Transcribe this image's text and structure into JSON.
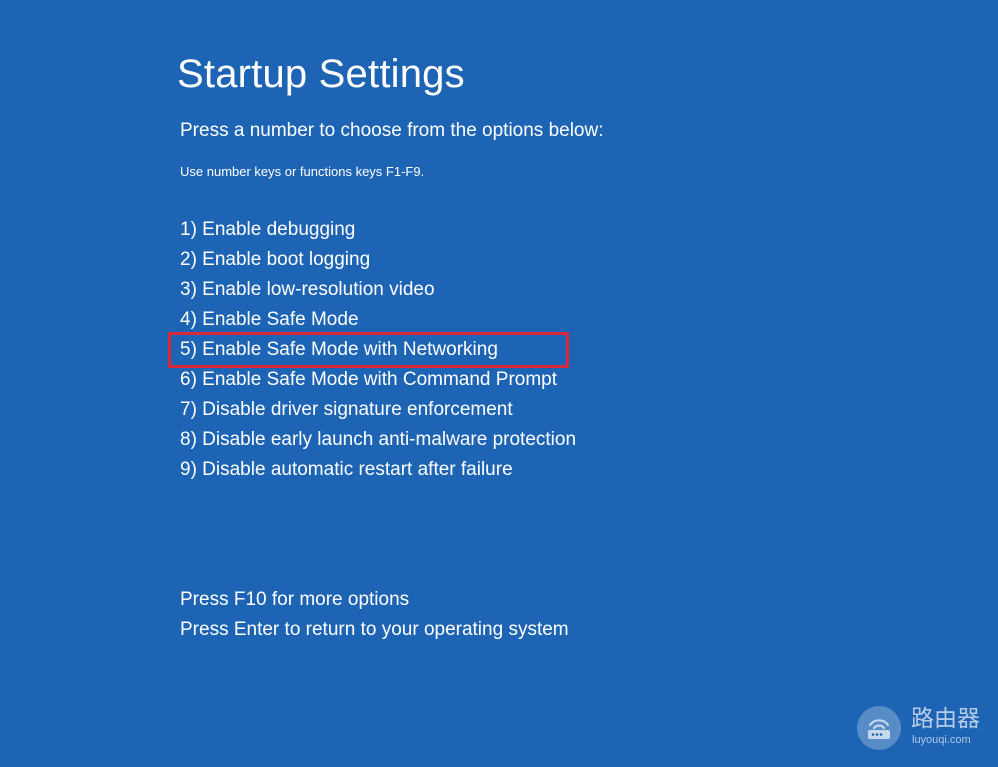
{
  "screen": {
    "title": "Startup Settings",
    "subtitle": "Press a number to choose from the options below:",
    "hint": "Use number keys or functions keys F1-F9.",
    "background_color": "#1e64b4",
    "highlight_color": "#d7283c"
  },
  "options": [
    {
      "label": "1) Enable debugging",
      "highlighted": false
    },
    {
      "label": "2) Enable boot logging",
      "highlighted": false
    },
    {
      "label": "3) Enable low-resolution video",
      "highlighted": false
    },
    {
      "label": "4) Enable Safe Mode",
      "highlighted": false
    },
    {
      "label": "5) Enable Safe Mode with Networking",
      "highlighted": true
    },
    {
      "label": "6) Enable Safe Mode with Command Prompt",
      "highlighted": false
    },
    {
      "label": "7) Disable driver signature enforcement",
      "highlighted": false
    },
    {
      "label": "8) Disable early launch anti-malware protection",
      "highlighted": false
    },
    {
      "label": "9) Disable automatic restart after failure",
      "highlighted": false
    }
  ],
  "footer": {
    "more_options": "Press F10 for more options",
    "return": "Press Enter to return to your operating system"
  },
  "watermark": {
    "name": "路由器",
    "url": "luyouqi.com",
    "icon": "router-logo-icon"
  }
}
